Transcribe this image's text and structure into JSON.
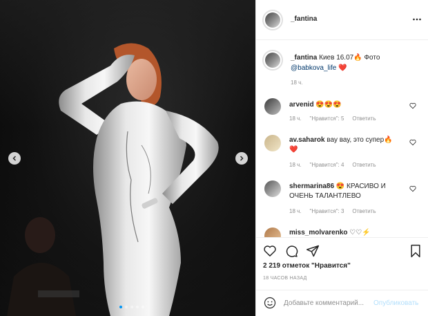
{
  "post": {
    "username": "_fantina",
    "more_icon": "more-horizontal-icon",
    "photo_alt": "performer on stage",
    "caption": {
      "username": "_fantina",
      "text": "Киев 16.07",
      "fire": "🔥",
      "photo_label": "Фото",
      "mention": "@babkova_life",
      "heart": "❤️",
      "time": "18 ч."
    },
    "comments": [
      {
        "username": "arvenid",
        "text": "😍😍😍",
        "time": "18 ч.",
        "likes": "\"Нравится\": 5",
        "reply": "Ответить"
      },
      {
        "username": "av.saharok",
        "text": "вау вау, это супер",
        "fire": "🔥",
        "heart": "❤️",
        "time": "18 ч.",
        "likes": "\"Нравится\": 4",
        "reply": "Ответить"
      },
      {
        "username": "shermarina86",
        "text": "😍 КРАСИВО И ОЧЕНЬ ТАЛАНТЛЕВО",
        "time": "18 ч.",
        "likes": "\"Нравится\": 3",
        "reply": "Ответить"
      },
      {
        "username": "miss_molvarenko",
        "text": "♡♡⚡"
      }
    ],
    "likes_text": "2 219 отметок \"Нравится\"",
    "posted_ago": "18 ЧАСОВ НАЗАД",
    "add_comment": {
      "placeholder": "Добавьте комментарий...",
      "publish": "Опубликовать"
    },
    "carousel": {
      "dots": 5,
      "active": 0
    }
  },
  "colors": {
    "accent": "#0095f6",
    "publish_disabled": "#b2dffc",
    "heart": "#ed4956",
    "muted": "#8e8e8e"
  }
}
